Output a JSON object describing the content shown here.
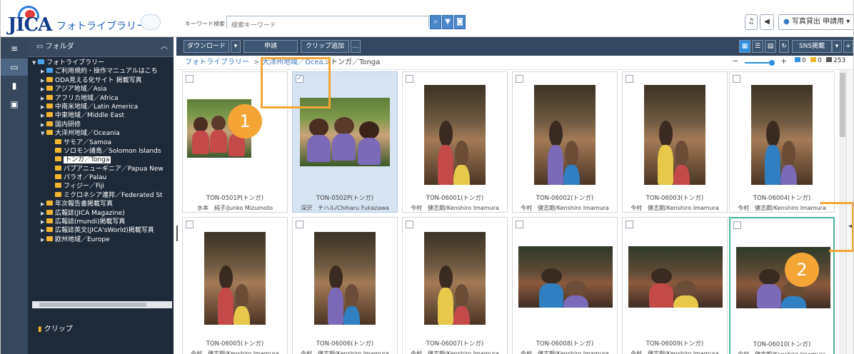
{
  "header": {
    "logo_text": "JICA",
    "app_title": "フォトライブラリー",
    "keyword_label": "キーワード検索",
    "search_placeholder": "検索キーワード",
    "bell_icon": "bell-icon",
    "sound_icon": "speaker-icon",
    "user_button": "写真貸出 申請用"
  },
  "sidebar": {
    "panel_title": "フォルダ",
    "clip_label": "クリップ",
    "tree": [
      {
        "label": "フォトライブラリー",
        "level": 0,
        "expanded": true,
        "color": "blue"
      },
      {
        "label": "ご利用規約・操作マニュアルはこち",
        "level": 1,
        "color": "blue"
      },
      {
        "label": "ODA見える化サイト 掲載写真",
        "level": 1,
        "color": "yellow"
      },
      {
        "label": "アジア地域／Asia",
        "level": 1,
        "color": "yellow"
      },
      {
        "label": "アフリカ地域／Africa",
        "level": 1,
        "color": "yellow"
      },
      {
        "label": "中南米地域／Latin America",
        "level": 1,
        "color": "yellow"
      },
      {
        "label": "中東地域／Middle East",
        "level": 1,
        "color": "yellow"
      },
      {
        "label": "国内研修",
        "level": 1,
        "color": "yellow"
      },
      {
        "label": "大洋州地域／Oceania",
        "level": 1,
        "expanded": true,
        "color": "yellow"
      },
      {
        "label": "サモア／Samoa",
        "level": 2,
        "color": "yellow"
      },
      {
        "label": "ソロモン諸島／Solomon Islands",
        "level": 2,
        "color": "yellow"
      },
      {
        "label": "トンガ／Tonga",
        "level": 2,
        "color": "yellow",
        "selected": true
      },
      {
        "label": "パプアニューギニア／Papua New",
        "level": 2,
        "color": "yellow"
      },
      {
        "label": "パラオ／Palau",
        "level": 2,
        "color": "yellow"
      },
      {
        "label": "フィジー／Fiji",
        "level": 2,
        "color": "yellow"
      },
      {
        "label": "ミクロネシア連邦／Federated St",
        "level": 2,
        "color": "yellow"
      },
      {
        "label": "年次報告書掲載写真",
        "level": 1,
        "color": "yellow"
      },
      {
        "label": "広報誌(JICA Magazine)",
        "level": 1,
        "color": "yellow"
      },
      {
        "label": "広報誌(mundi)掲載写真",
        "level": 1,
        "color": "yellow"
      },
      {
        "label": "広報誌英文(JICA'sWorld)掲載写真",
        "level": 1,
        "color": "yellow"
      },
      {
        "label": "欧州地域／Europe",
        "level": 1,
        "color": "yellow"
      }
    ]
  },
  "toolbar": {
    "download": "ダウンロード",
    "apply": "申請",
    "clip_add": "クリップ追加",
    "more": "…",
    "sns": "SNS掲載"
  },
  "breadcrumb": [
    "フォトライブラリー",
    "大洋州地域／Ocea...",
    "トンガ／Tonga"
  ],
  "counts": {
    "a": "0",
    "b": "0",
    "total": "253"
  },
  "photos": [
    {
      "id": "TON-0501P(トンガ)",
      "credit": "水本　純子/Junko Mizumoto",
      "checked": false,
      "style": "kids"
    },
    {
      "id": "TON-0502P(トンガ)",
      "credit": "深沢　チハル/Chiharu Fukazawa",
      "checked": true,
      "style": "kids"
    },
    {
      "id": "TON-06001(トンガ)",
      "credit": "今村　健志朗/Kenshiro Imamura",
      "checked": false,
      "style": "port"
    },
    {
      "id": "TON-06002(トンガ)",
      "credit": "今村　健志朗/Kenshiro Imamura",
      "checked": false,
      "style": "port"
    },
    {
      "id": "TON-06003(トンガ)",
      "credit": "今村　健志朗/Kenshiro Imamura",
      "checked": false,
      "style": "port"
    },
    {
      "id": "TON-06004(トンガ)",
      "credit": "今村　健志朗/Kenshiro Imamura",
      "checked": false,
      "style": "port"
    },
    {
      "id": "TON-06005(トンガ)",
      "credit": "今村　健志朗/Kenshiro Imamura",
      "checked": false,
      "style": "port"
    },
    {
      "id": "TON-06006(トンガ)",
      "credit": "今村　健志朗/Kenshiro Imamura",
      "checked": false,
      "style": "port"
    },
    {
      "id": "TON-06007(トンガ)",
      "credit": "今村　健志朗/Kenshiro Imamura",
      "checked": false,
      "style": "port"
    },
    {
      "id": "TON-06008(トンガ)",
      "credit": "今村　健志朗/Kenshiro Imamura",
      "checked": false,
      "style": "land"
    },
    {
      "id": "TON-06009(トンガ)",
      "credit": "今村　健志朗/Kenshiro Imamura",
      "checked": false,
      "style": "land"
    },
    {
      "id": "TON-06010(トンガ)",
      "credit": "今村　健志朗/Kenshiro Imamura",
      "checked": false,
      "style": "land",
      "focused": true
    }
  ],
  "annotations": {
    "badge1": "1",
    "badge2": "2"
  },
  "colors": {
    "accent": "#f5a536",
    "nav_dark": "#1f2a38",
    "toolbar": "#34475f",
    "link": "#3b79c3"
  }
}
